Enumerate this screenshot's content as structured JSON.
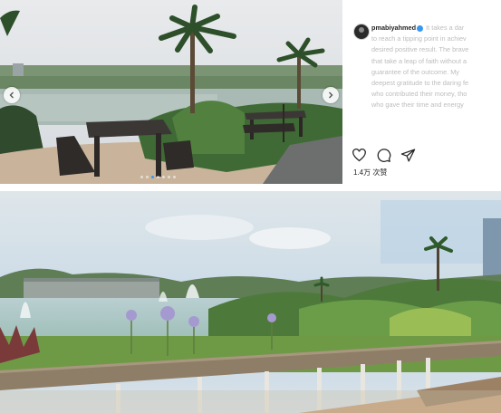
{
  "post": {
    "username": "pmabiyahmed",
    "verified": true,
    "caption_lines": [
      "It takes a dar",
      "to reach a tipping point in achiev",
      "desired positive result. The brave",
      "that take a leap of faith without a",
      "guarantee of the outcome. My",
      "deepest gratitude to the daring fe",
      "who contributed their money, tho",
      "who gave their time and energy"
    ],
    "likes": "1.4万 次赞",
    "carousel": {
      "slide_count": 7,
      "active_index": 2
    },
    "icons": {
      "like": "heart-icon",
      "comment": "comment-icon",
      "share": "send-icon",
      "prev": "chevron-left-icon",
      "next": "chevron-right-icon",
      "avatar": "avatar-image"
    }
  },
  "photos": {
    "slide_image": "park with picnic tables, palm trees and lake",
    "bottom_image": "wooden boardwalk railing overlooking lake with fountains, flowers and palm trees"
  },
  "colors": {
    "accent": "#3897f0",
    "text": "#262626",
    "muted": "#bdbdbd"
  }
}
